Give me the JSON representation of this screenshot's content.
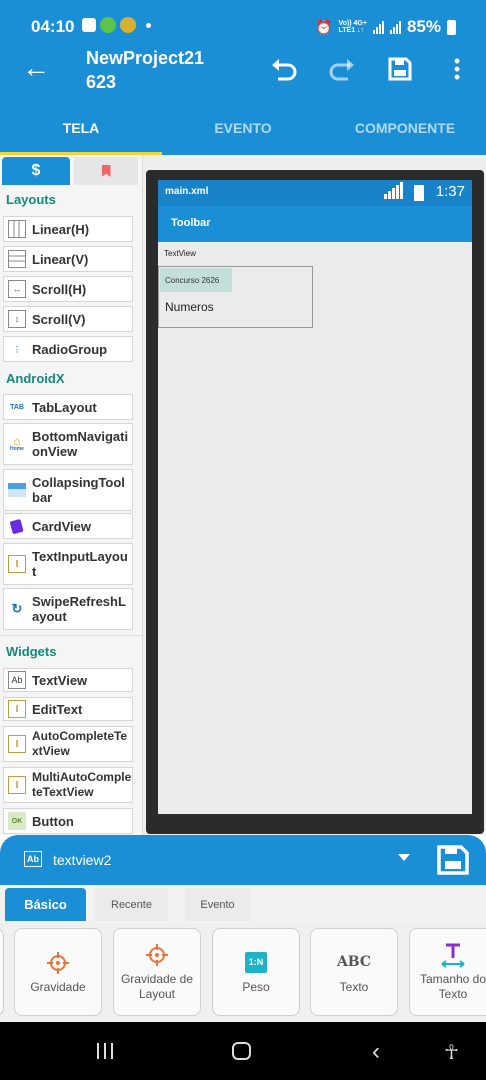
{
  "status_bar": {
    "time": "04:10",
    "network_top": "Vo)) 4G+",
    "network_bottom": "LTE1 ↓↑",
    "battery": "85%"
  },
  "app_bar": {
    "title": "NewProject21",
    "subtitle": "623"
  },
  "tabs": [
    "TELA",
    "EVENTO",
    "COMPONENTE"
  ],
  "palette": {
    "tab_icon": "$",
    "sections": [
      {
        "title": "Layouts"
      },
      {
        "title": "AndroidX"
      },
      {
        "title": "Widgets"
      }
    ],
    "layouts": [
      {
        "label": "Linear(H)",
        "icon": "linear-h-icon"
      },
      {
        "label": "Linear(V)",
        "icon": "linear-v-icon"
      },
      {
        "label": "Scroll(H)",
        "icon": "scroll-h-icon"
      },
      {
        "label": "Scroll(V)",
        "icon": "scroll-v-icon"
      },
      {
        "label": "RadioGroup",
        "icon": "radiogroup-icon"
      }
    ],
    "androidx": [
      {
        "label": "TabLayout",
        "icon_text": "TAB"
      },
      {
        "label": "BottomNavigationView",
        "icon_text": "Home"
      },
      {
        "label": "CollapsingToolbar",
        "icon": "collapsing-toolbar-icon"
      },
      {
        "label": "CardView",
        "icon": "cardview-icon"
      },
      {
        "label": "TextInputLayout",
        "icon_text": "I"
      },
      {
        "label": "SwipeRefreshLayout",
        "icon": "refresh-icon"
      }
    ],
    "widgets": [
      {
        "label": "TextView",
        "icon_text": "Ab"
      },
      {
        "label": "EditText",
        "icon_text": "I"
      },
      {
        "label": "AutoCompleteTextView",
        "icon_text": "I"
      },
      {
        "label": "MultiAutoCompleteTextView",
        "icon_text": "I"
      },
      {
        "label": "Button",
        "icon_text": "OK"
      }
    ]
  },
  "preview": {
    "file_name": "main.xml",
    "time": "1:37",
    "toolbar_title": "Toolbar",
    "textview_label": "TextView",
    "concurso_text": "Concurso 2626",
    "numeros_text": "Numeros"
  },
  "selection": {
    "icon_text": "Ab",
    "name": "textview2"
  },
  "property_tabs": [
    "Básico",
    "Recente",
    "Evento"
  ],
  "properties": [
    {
      "label": "Gravidade",
      "icon": "gravity-icon"
    },
    {
      "label": "Gravidade de Layout",
      "icon": "layout-gravity-icon"
    },
    {
      "label": "Peso",
      "icon_text": "1:N"
    },
    {
      "label": "Texto",
      "icon_text": "ABC"
    },
    {
      "label": "Tamanho do Texto",
      "icon": "text-size-icon"
    }
  ],
  "colors": {
    "primary": "#1b8fd6",
    "accent": "#f2d43a",
    "section": "#118a7e"
  }
}
